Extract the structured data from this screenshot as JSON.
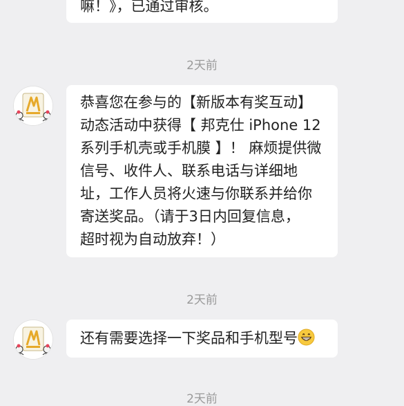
{
  "chat": {
    "prev_message": {
      "tail_text": "嘛！》，已通过审核。"
    },
    "messages": [
      {
        "time": "2天前",
        "lines": [
          "恭喜您在参与的【新版本有奖互动】",
          "动态活动中获得【 邦克仕 iPhone 12",
          "系列手机壳或手机膜 】！ 麻烦提供微",
          "信号、收件人、联系电话与详细地",
          "址，工作人员将火速与你联系并给你",
          "寄送奖品。（请于3日内回复信息，",
          "超时视为自动放弃！）"
        ]
      },
      {
        "time": "2天前",
        "text": "还有需要选择一下奖品和手机型号",
        "emoji": "grinning-emoji"
      },
      {
        "time": "2天前"
      }
    ]
  },
  "avatar_icon": "cartoon-character-avatar",
  "colors": {
    "background": "#efeff1",
    "bubble": "#ffffff",
    "time": "#9a9a9a",
    "text": "#222222"
  }
}
